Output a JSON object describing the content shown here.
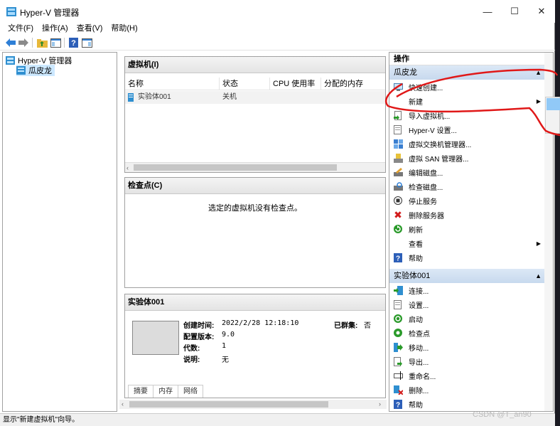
{
  "window": {
    "title": "Hyper-V 管理器"
  },
  "menu": {
    "file": "文件(F)",
    "action": "操作(A)",
    "view": "查看(V)",
    "help": "帮助(H)"
  },
  "tree": {
    "root": "Hyper-V 管理器",
    "server": "瓜皮龙"
  },
  "vms": {
    "header": "虚拟机(I)",
    "columns": [
      "名称",
      "状态",
      "CPU 使用率",
      "分配的内存"
    ],
    "rows": [
      {
        "name": "实验体001",
        "state": "关机"
      }
    ]
  },
  "checkpoints": {
    "header": "检查点(C)",
    "empty": "选定的虚拟机没有检查点。"
  },
  "details": {
    "header": "实验体001",
    "created_label": "创建时间:",
    "created_value": "2022/2/28 12:18:10",
    "clustered_label": "已群集:",
    "clustered_value": "否",
    "version_label": "配置版本:",
    "version_value": "9.0",
    "generation_label": "代数:",
    "generation_value": "1",
    "notes_label": "说明:",
    "notes_value": "无",
    "tabs": [
      "摘要",
      "内存",
      "网络"
    ]
  },
  "actions": {
    "title": "操作",
    "server_group": "瓜皮龙",
    "server_items": [
      "快速创建...",
      "新建",
      "导入虚拟机...",
      "Hyper-V 设置...",
      "虚拟交换机管理器...",
      "虚拟 SAN 管理器...",
      "编辑磁盘...",
      "检查磁盘...",
      "停止服务",
      "删除服务器",
      "刷新",
      "查看",
      "帮助"
    ],
    "vm_group": "实验体001",
    "vm_items": [
      "连接...",
      "设置...",
      "启动",
      "检查点",
      "移动...",
      "导出...",
      "重命名...",
      "删除...",
      "帮助"
    ]
  },
  "status": {
    "text": "显示\"新建虚拟机\"向导。"
  },
  "watermark": "CSDN @T_an90",
  "colors": {
    "selection": "#cce8ff",
    "group_header": "#c7d9ee",
    "annotation": "#e01818",
    "hover": "#91c9f7"
  }
}
